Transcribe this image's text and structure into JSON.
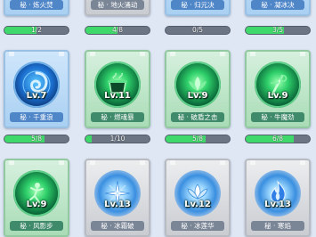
{
  "cards": [
    {
      "name": "秘 · 炼火焚",
      "level": "",
      "progress": "1/2",
      "fill": 0.5,
      "theme": "blue",
      "icon": "fire-icon"
    },
    {
      "name": "秘 · 地火涌动",
      "level": "",
      "progress": "4/8",
      "fill": 0.5,
      "theme": "silver",
      "icon": "lava-icon"
    },
    {
      "name": "秘 · 归元决",
      "level": "",
      "progress": "0/5",
      "fill": 0.0,
      "theme": "blue",
      "icon": "orb-icon"
    },
    {
      "name": "秘 · 凝冰决",
      "level": "",
      "progress": "3/5",
      "fill": 0.6,
      "theme": "blue",
      "icon": "ice-icon"
    },
    {
      "name": "秘 · 千重浪",
      "level": "Lv.7",
      "progress": "5/8",
      "fill": 0.625,
      "theme": "blue",
      "icon": "whirlpool-icon"
    },
    {
      "name": "秘 · 燃魂暴",
      "level": "Lv.11",
      "progress": "1/10",
      "fill": 0.1,
      "theme": "green",
      "icon": "cauldron-icon"
    },
    {
      "name": "秘 · 破盾之击",
      "level": "Lv.9",
      "progress": "5/8",
      "fill": 0.625,
      "theme": "green",
      "icon": "lotus-icon"
    },
    {
      "name": "秘 · 牛魔劲",
      "level": "Lv.9",
      "progress": "6/8",
      "fill": 0.75,
      "theme": "green",
      "icon": "staff-icon"
    },
    {
      "name": "秘 · 风影步",
      "level": "Lv.9",
      "progress": "",
      "fill": 0,
      "theme": "green",
      "icon": "dancer-icon"
    },
    {
      "name": "秘 · 冰霜破",
      "level": "Lv.13",
      "progress": "",
      "fill": 0,
      "theme": "silver",
      "icon": "ice-burst-icon"
    },
    {
      "name": "秘 · 冰莲华",
      "level": "Lv.12",
      "progress": "",
      "fill": 0,
      "theme": "silver",
      "icon": "ice-lotus-icon"
    },
    {
      "name": "秘 · 寒焰",
      "level": "Lv.13",
      "progress": "",
      "fill": 0,
      "theme": "silver",
      "icon": "blue-flame-icon"
    }
  ]
}
